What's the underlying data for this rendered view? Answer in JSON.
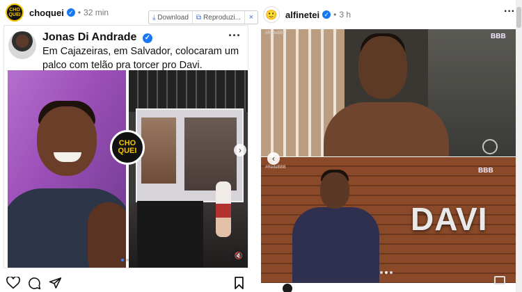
{
  "left_post": {
    "handle": "choquei",
    "time": "32 min",
    "avatar_text": "CHO QUEI",
    "toolbar": {
      "download_label": "Download",
      "reproduce_label": "Reproduzi...",
      "close_label": "×"
    },
    "tweet": {
      "author": "Jonas Di Andrade",
      "text": "Em Cajazeiras, em Salvador, colocaram um palco com telão pra torcer pro Davi."
    },
    "logo_line1": "CHO",
    "logo_line2": "QUEI",
    "carousel_dots": 2,
    "active_dot": 0
  },
  "right_post": {
    "handle": "alfinetei",
    "time": "3 h",
    "top_video_label": "BBB",
    "bottom_video_label": "BBB",
    "watermark": "#RedeBBB",
    "banner_text": "DAVI",
    "carousel_dots": 3,
    "active_dot": 1
  },
  "icons": {
    "like": "heart-icon",
    "comment": "comment-icon",
    "share": "share-icon",
    "save": "bookmark-icon",
    "verified": "verified-badge-icon",
    "more": "more-options-icon"
  },
  "colors": {
    "verified_blue": "#1877f2",
    "choquei_yellow": "#f5c400"
  }
}
